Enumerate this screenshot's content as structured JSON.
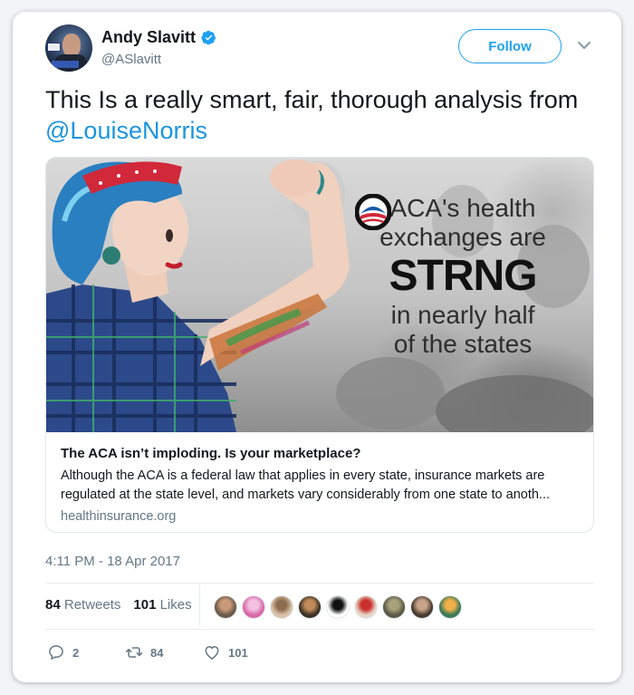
{
  "tweet": {
    "author": {
      "name": "Andy Slavitt",
      "handle": "@ASlavitt",
      "verified": true,
      "avatar_icon": "avatar-photo"
    },
    "follow_label": "Follow",
    "text_before": "This Is a really smart, fair, thorough analysis from ",
    "mention": "@LouiseNorris",
    "card": {
      "image": {
        "line1": "ACA's health",
        "line2": "exchanges are",
        "strong_pre": "STR",
        "strong_post": "NG",
        "line3": "in nearly half",
        "line4": "of the states"
      },
      "title": "The ACA isn’t imploding. Is your marketplace?",
      "description": "Although the ACA is a federal law that applies in every state, insurance markets are regulated at the state level, and markets vary considerably from one state to anoth...",
      "domain": "healthinsurance.org"
    },
    "timestamp": "4:11 PM - 18 Apr 2017",
    "stats": {
      "retweets_count": "84",
      "retweets_label": "Retweets",
      "likes_count": "101",
      "likes_label": "Likes"
    },
    "likers": [
      {
        "color": "#6b5a4a",
        "accent": "#c99a7a"
      },
      {
        "color": "#d86aa9",
        "accent": "#f4c2e0"
      },
      {
        "color": "#d9c2a8",
        "accent": "#8d6c50"
      },
      {
        "color": "#3c3225",
        "accent": "#c08a5a"
      },
      {
        "color": "#ffffff",
        "accent": "#111111"
      },
      {
        "color": "#e8d7c8",
        "accent": "#c9302c"
      },
      {
        "color": "#5b5a46",
        "accent": "#a8a27c"
      },
      {
        "color": "#4a3b30",
        "accent": "#c8a48a"
      },
      {
        "color": "#3b7a57",
        "accent": "#f0b04a"
      }
    ],
    "actions": {
      "reply_count": "2",
      "retweet_count": "84",
      "like_count": "101"
    },
    "colors": {
      "accent": "#1da1f2",
      "link": "#1b95e0",
      "muted": "#657786"
    }
  }
}
